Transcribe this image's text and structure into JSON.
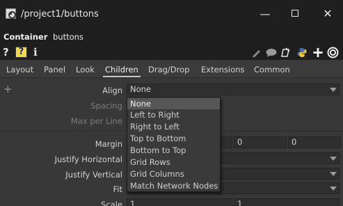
{
  "window": {
    "title": "/project1/buttons"
  },
  "path": {
    "label": "Container",
    "name": "buttons"
  },
  "toolbar": {
    "help_q": "?",
    "help_box": "?",
    "info": "i"
  },
  "tabs": [
    {
      "label": "Layout"
    },
    {
      "label": "Panel"
    },
    {
      "label": "Look"
    },
    {
      "label": "Children",
      "active": true
    },
    {
      "label": "Drag/Drop"
    },
    {
      "label": "Extensions"
    },
    {
      "label": "Common"
    }
  ],
  "params": {
    "align": {
      "label": "Align",
      "value": "None"
    },
    "spacing": {
      "label": "Spacing"
    },
    "max_per_line": {
      "label": "Max per Line"
    },
    "margin": {
      "label": "Margin",
      "values": [
        "",
        "0",
        "0"
      ]
    },
    "justify_horizontal": {
      "label": "Justify Horizontal"
    },
    "justify_vertical": {
      "label": "Justify Vertical"
    },
    "fit": {
      "label": "Fit"
    },
    "scale": {
      "label": "Scale",
      "values": [
        "1",
        "1"
      ]
    }
  },
  "align_options": [
    "None",
    "Left to Right",
    "Right to Left",
    "Top to Bottom",
    "Bottom to Top",
    "Grid Rows",
    "Grid Columns",
    "Match Network Nodes"
  ],
  "colors": {
    "help_box_bg": "#f2d94e",
    "help_box_fg": "#1b1f9a",
    "python_blue": "#3a6fb0",
    "python_yellow": "#f3c63c"
  },
  "icons": [
    "app-icon",
    "minimize-icon",
    "maximize-icon",
    "close-icon",
    "pencil-icon",
    "comment-icon",
    "clip-icon",
    "python-icon",
    "add-icon",
    "target-icon"
  ]
}
